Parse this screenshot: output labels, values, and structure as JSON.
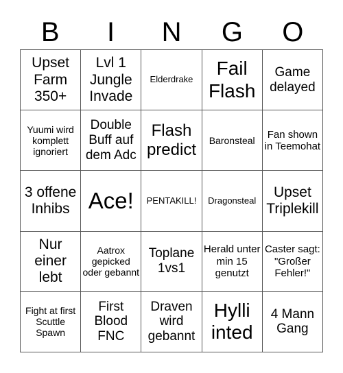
{
  "header": {
    "letters": [
      "B",
      "I",
      "N",
      "G",
      "O"
    ]
  },
  "cells": [
    "Upset Farm 350+",
    "Lvl 1 Jungle Invade",
    "Elderdrake",
    "Fail Flash",
    "Game delayed",
    "Yuumi wird komplett ignoriert",
    "Double Buff auf dem Adc",
    "Flash predict",
    "Baronsteal",
    "Fan shown in Teemohat",
    "3 offene Inhibs",
    "Ace!",
    "PENTAKILL!",
    "Dragonsteal",
    "Upset Triplekill",
    "Nur einer lebt",
    "Aatrox gepicked oder gebannt",
    "Toplane 1vs1",
    "Herald unter min 15 genutzt",
    "Caster sagt: \"Großer Fehler!\"",
    "Fight at first Scuttle Spawn",
    "First Blood FNC",
    "Draven wird gebannt",
    "Hylli inted",
    "4 Mann Gang"
  ]
}
